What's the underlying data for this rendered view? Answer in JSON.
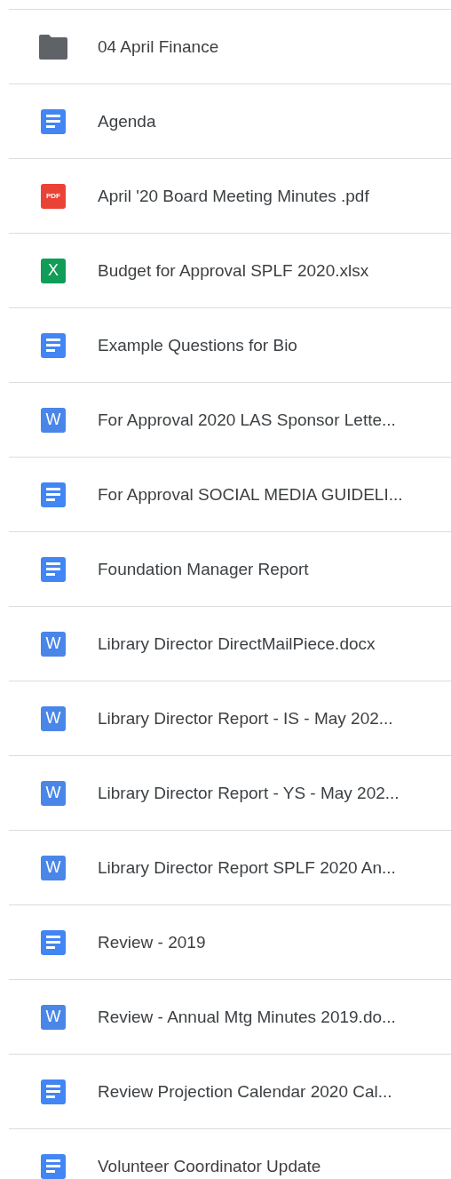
{
  "files": [
    {
      "kind": "folder",
      "name": "04 April Finance"
    },
    {
      "kind": "doc",
      "name": "Agenda"
    },
    {
      "kind": "pdf",
      "badge": "PDF",
      "name": "April '20 Board Meeting Minutes .pdf"
    },
    {
      "kind": "sheet",
      "badge": "X",
      "name": "Budget for Approval SPLF 2020.xlsx"
    },
    {
      "kind": "doc",
      "name": "Example Questions for Bio"
    },
    {
      "kind": "word",
      "badge": "W",
      "name": "For Approval 2020 LAS Sponsor Lette..."
    },
    {
      "kind": "doc",
      "name": "For Approval SOCIAL MEDIA GUIDELI..."
    },
    {
      "kind": "doc",
      "name": "Foundation Manager Report"
    },
    {
      "kind": "word",
      "badge": "W",
      "name": "Library Director DirectMailPiece.docx"
    },
    {
      "kind": "word",
      "badge": "W",
      "name": "Library Director Report - IS - May 202..."
    },
    {
      "kind": "word",
      "badge": "W",
      "name": "Library Director Report - YS - May 202..."
    },
    {
      "kind": "word",
      "badge": "W",
      "name": "Library Director Report SPLF 2020 An..."
    },
    {
      "kind": "doc",
      "name": "Review - 2019"
    },
    {
      "kind": "word",
      "badge": "W",
      "name": "Review - Annual Mtg Minutes 2019.do..."
    },
    {
      "kind": "doc",
      "name": "Review Projection Calendar 2020 Cal..."
    },
    {
      "kind": "doc",
      "name": "Volunteer Coordinator Update"
    }
  ]
}
